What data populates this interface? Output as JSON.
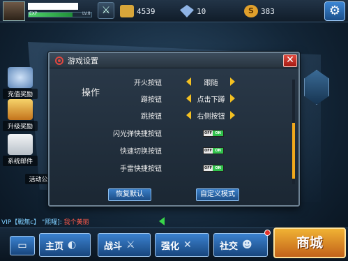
{
  "topbar": {
    "exp_label": "EXP",
    "level_label": "LV.8",
    "resources": [
      {
        "name": "gold",
        "value": "4539",
        "color": "#d8a63a"
      },
      {
        "name": "diamond",
        "value": "10",
        "color": "#8fb4e6"
      },
      {
        "name": "silver",
        "value": "383",
        "color": "#e0a02c"
      }
    ],
    "exp_progress": 0.7
  },
  "side_events": [
    {
      "label": "充值奖励",
      "color": "#7fa8d8"
    },
    {
      "label": "升级奖励",
      "color": "#e0a43a"
    },
    {
      "label": "系统邮件",
      "color": "#d8dde4"
    }
  ],
  "side_partial": "活动公",
  "dialog": {
    "title": "游戏设置",
    "close_symbol": "✕",
    "section": "操作",
    "rows": [
      {
        "label": "开火按钮",
        "type": "select",
        "value": "跟随"
      },
      {
        "label": "蹲按钮",
        "type": "select",
        "value": "点击下蹲"
      },
      {
        "label": "跳按钮",
        "type": "select",
        "value": "右侧按钮"
      },
      {
        "label": "闪光弹快捷按钮",
        "type": "toggle",
        "off": "OFF",
        "on": "ON"
      },
      {
        "label": "快速切换按钮",
        "type": "toggle",
        "off": "OFF",
        "on": "ON"
      },
      {
        "label": "手雷快捷按钮",
        "type": "toggle",
        "off": "OFF",
        "on": "ON"
      }
    ],
    "reset_button": "恢复默认",
    "custom_button": "自定义模式"
  },
  "chat": {
    "prefix": "VIP【戰無c】 \"熙曜]:",
    "message": "我个美丽"
  },
  "bottom_nav": {
    "home": "主页",
    "battle": "战斗",
    "upgrade": "强化",
    "social": "社交",
    "shop": "商城"
  }
}
